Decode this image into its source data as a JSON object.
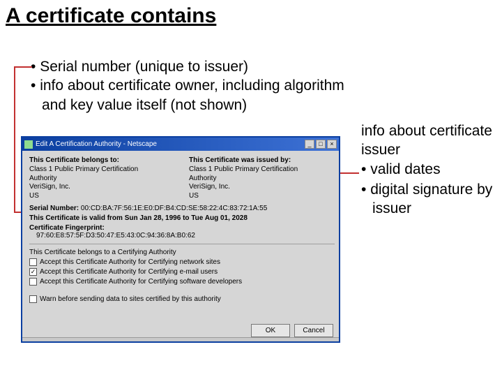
{
  "slide": {
    "title": "A certificate contains",
    "bullets_top": [
      "Serial number (unique to issuer)",
      "info about certificate owner, including algorithm and key value itself (not shown)"
    ],
    "bullets_right_first": "info about certificate issuer",
    "bullets_right": [
      "valid dates",
      "digital signature by issuer"
    ]
  },
  "dialog": {
    "title": "Edit A Certification Authority - Netscape",
    "belongs_header": "This Certificate belongs to:",
    "issued_header": "This Certificate was issued by:",
    "belongs_lines": [
      "Class 1 Public Primary Certification",
      "Authority",
      "VeriSign, Inc.",
      "US"
    ],
    "issued_lines": [
      "Class 1 Public Primary Certification",
      "Authority",
      "VeriSign, Inc.",
      "US"
    ],
    "serial_label": "Serial Number:",
    "serial_value": "00:CD:BA:7F:56:1E:E0:DF:B4:CD:SE:58:22:4C:83:72:1A:55",
    "valid_text": "This Certificate is valid from Sun Jan 28, 1996 to Tue Aug 01, 2028",
    "fingerprint_label": "Certificate Fingerprint:",
    "fingerprint_value": "97:60:E8:57:5F:D3:50:47:E5:43:0C:94:36:8A:B0:62",
    "belongs_ca": "This Certificate belongs to a Certifying Authority",
    "chk1": "Accept this Certificate Authority for Certifying network sites",
    "chk2": "Accept this Certificate Authority for Certifying e-mail users",
    "chk3": "Accept this Certificate Authority for Certifying software developers",
    "chk4": "Warn before sending data to sites certified by this authority",
    "chk2_checked": "✓",
    "ok": "OK",
    "cancel": "Cancel"
  }
}
